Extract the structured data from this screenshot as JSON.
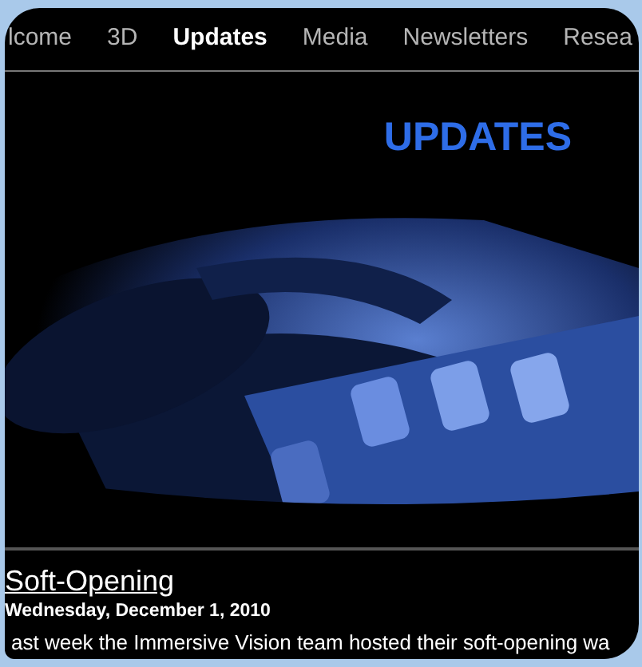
{
  "nav": [
    {
      "label": "lcome",
      "selected": false
    },
    {
      "label": "3D",
      "selected": false
    },
    {
      "label": "Updates",
      "selected": true
    },
    {
      "label": "Media",
      "selected": false
    },
    {
      "label": "Newsletters",
      "selected": false
    },
    {
      "label": "Resea",
      "selected": false
    }
  ],
  "heading": "UPDATES",
  "post": {
    "title": "Soft-Opening",
    "date": "Wednesday, December 1, 2010",
    "excerpt": "ast week the Immersive Vision team hosted their soft-opening wa"
  }
}
